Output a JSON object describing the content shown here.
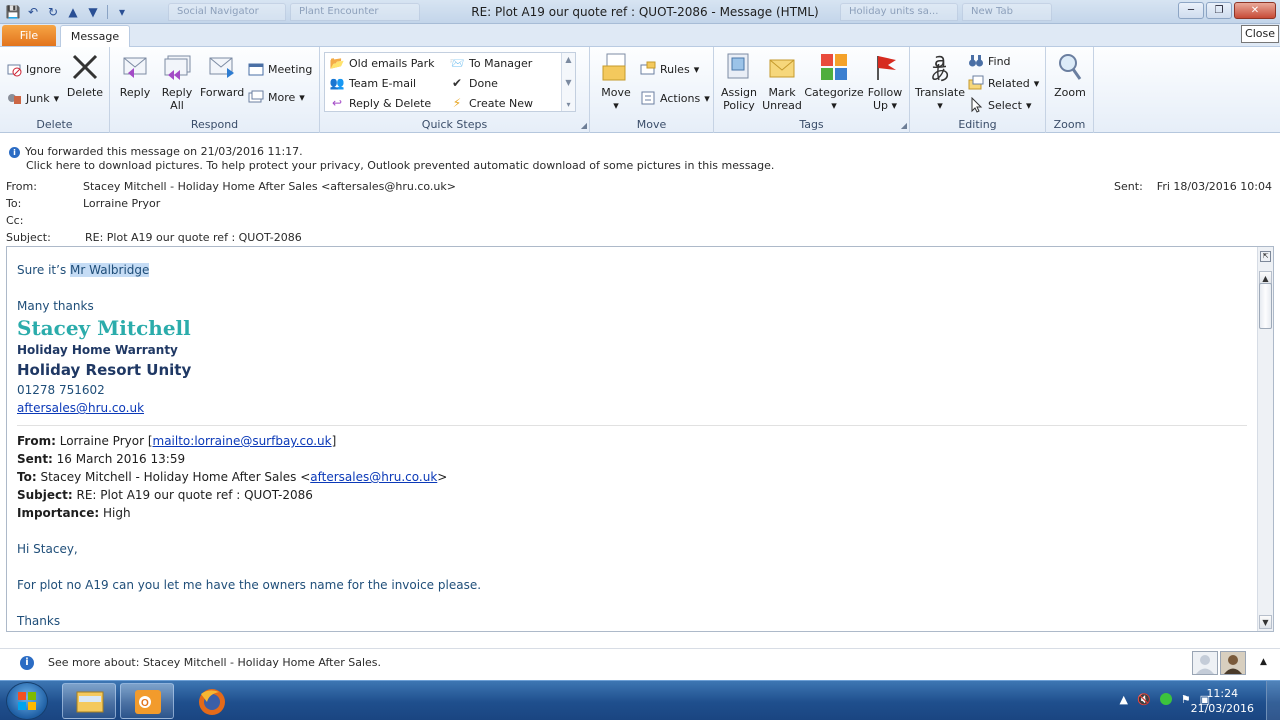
{
  "window": {
    "title": "RE: Plot A19  our quote ref : QUOT-2086  -  Message (HTML)",
    "close_tooltip": "Close",
    "background_tabs": [
      "Social Navigator",
      "Plant Encounter",
      "",
      "Holiday units sa...",
      "New Tab"
    ]
  },
  "ribbon": {
    "tabs": {
      "file": "File",
      "message": "Message"
    },
    "delete_group": {
      "label": "Delete",
      "ignore": "Ignore",
      "junk": "Junk",
      "delete": "Delete"
    },
    "respond_group": {
      "label": "Respond",
      "reply": "Reply",
      "reply_all_1": "Reply",
      "reply_all_2": "All",
      "forward": "Forward",
      "meeting": "Meeting",
      "more": "More"
    },
    "quick_steps": {
      "label": "Quick Steps",
      "items": [
        "Old emails Park",
        "To Manager",
        "Team E-mail",
        "Done",
        "Reply & Delete",
        "Create New"
      ]
    },
    "move_group": {
      "label": "Move",
      "move": "Move",
      "rules": "Rules",
      "actions": "Actions"
    },
    "tags_group": {
      "label": "Tags",
      "assign_1": "Assign",
      "assign_2": "Policy",
      "mark_1": "Mark",
      "mark_2": "Unread",
      "categorize": "Categorize",
      "follow_1": "Follow",
      "follow_2": "Up"
    },
    "editing_group": {
      "label": "Editing",
      "translate": "Translate",
      "find": "Find",
      "related": "Related",
      "select": "Select"
    },
    "zoom_group": {
      "label": "Zoom",
      "zoom": "Zoom"
    }
  },
  "info": {
    "line1": "You forwarded this message on 21/03/2016 11:17.",
    "line2": "Click here to download pictures. To help protect your privacy, Outlook prevented automatic download of some pictures in this message."
  },
  "header": {
    "from_label": "From:",
    "from_value": "Stacey Mitchell - Holiday Home After Sales <aftersales@hru.co.uk>",
    "to_label": "To:",
    "to_value": "Lorraine Pryor",
    "cc_label": "Cc:",
    "subject_label": "Subject:",
    "subject_value": "RE: Plot A19  our quote ref : QUOT-2086",
    "sent_label": "Sent:",
    "sent_value": "Fri 18/03/2016 10:04"
  },
  "body": {
    "greeting_prefix": "Sure it’s ",
    "greeting_highlight": "Mr Walbridge",
    "thanks": "Many thanks",
    "sig_name": "Stacey Mitchell",
    "sig_title": "Holiday Home Warranty",
    "sig_company": "Holiday Resort Unity",
    "sig_phone": "01278 751602",
    "sig_email": "aftersales@hru.co.uk",
    "quoted": {
      "from_label": "From:",
      "from_name": " Lorraine Pryor [",
      "from_link": "mailto:lorraine@surfbay.co.uk",
      "from_end": "]",
      "sent_label": "Sent:",
      "sent_value": " 16 March 2016 13:59",
      "to_label": "To:",
      "to_value": " Stacey Mitchell - Holiday Home After Sales <",
      "to_link": "aftersales@hru.co.uk",
      "to_end": ">",
      "subject_label": "Subject:",
      "subject_value": " RE: Plot A19 our quote ref : QUOT-2086",
      "importance_label": "Importance:",
      "importance_value": " High",
      "hi": "Hi Stacey,",
      "request": "For plot no A19 can you let me have the owners name for the invoice please.",
      "thanks": "Thanks"
    }
  },
  "footer": {
    "text": "See more about: Stacey Mitchell - Holiday Home After Sales."
  },
  "taskbar": {
    "time": "11:24",
    "date": "21/03/2016"
  },
  "colors": {
    "accent": "#2b6cc4",
    "file_tab": "#e2741d",
    "signature_name": "#2bacab",
    "body_text": "#1f4e79"
  }
}
